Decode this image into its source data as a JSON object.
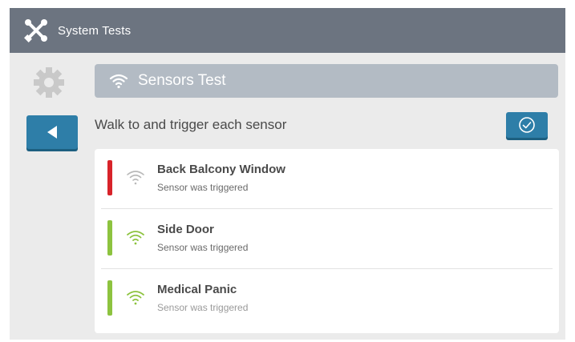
{
  "app": {
    "title": "System Tests",
    "icon": "tools-icon"
  },
  "nav": {
    "back_icon": "back-arrow-icon",
    "settings_icon": "gear-icon"
  },
  "test": {
    "title": "Sensors Test",
    "icon": "wifi-icon",
    "instruction": "Walk to and trigger each sensor",
    "done_icon": "check-circle-icon"
  },
  "sensors": [
    {
      "name": "Back Balcony Window",
      "status": "Sensor was triggered",
      "indicator_color": "#d8232a",
      "signal_color": "#b9b9b9"
    },
    {
      "name": "Side Door",
      "status": "Sensor was triggered",
      "indicator_color": "#8dc33f",
      "signal_color": "#8dc33f"
    },
    {
      "name": "Medical Panic",
      "status": "Sensor was triggered",
      "indicator_color": "#8dc33f",
      "signal_color": "#8dc33f"
    }
  ],
  "colors": {
    "topbar": "#6c7480",
    "accent": "#2e7ea8",
    "header": "#b3bbc4",
    "triggered_red": "#d8232a",
    "triggered_green": "#8dc33f"
  }
}
